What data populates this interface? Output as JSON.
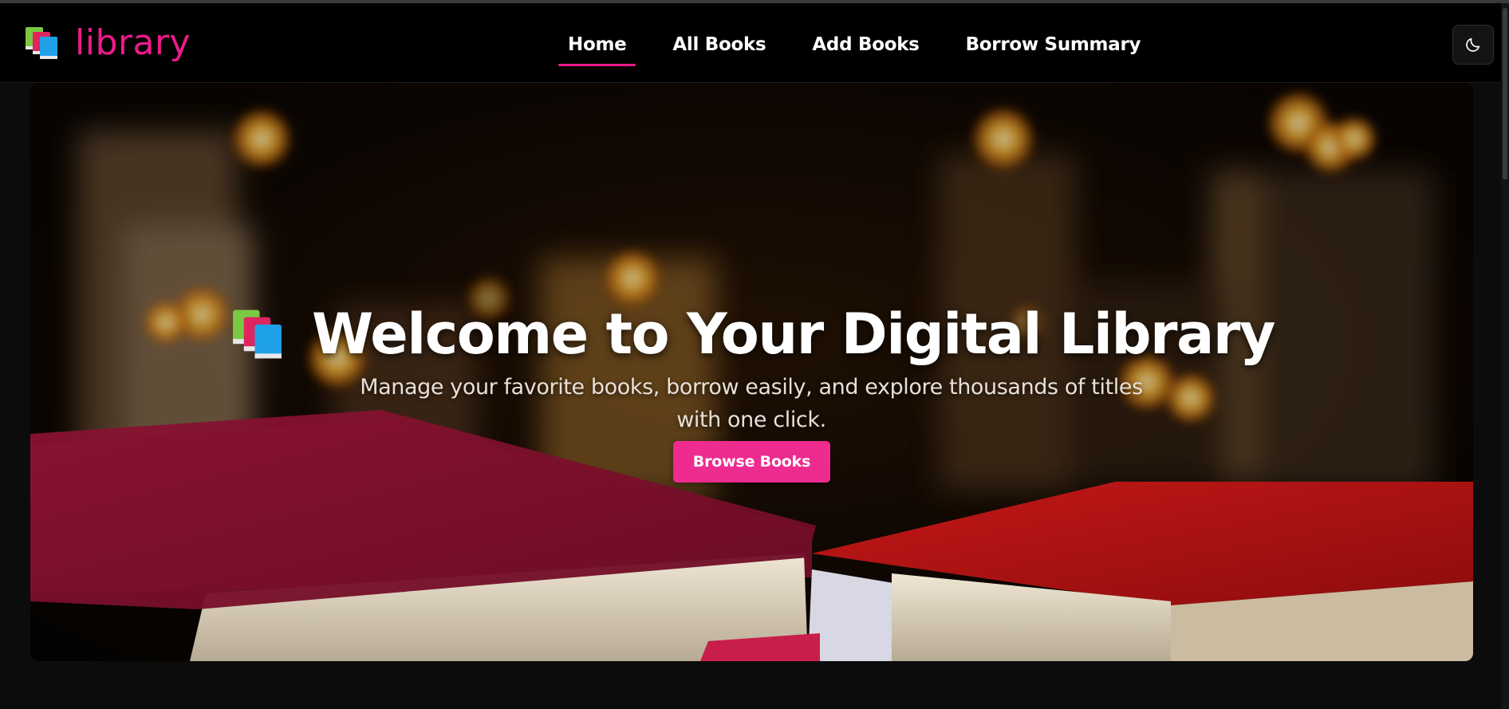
{
  "brand": {
    "name": "library",
    "icon": "books-icon"
  },
  "nav": {
    "links": [
      {
        "label": "Home",
        "active": true
      },
      {
        "label": "All Books",
        "active": false
      },
      {
        "label": "Add Books",
        "active": false
      },
      {
        "label": "Borrow Summary",
        "active": false
      }
    ]
  },
  "theme_toggle": {
    "icon": "moon-icon"
  },
  "hero": {
    "icon": "books-icon",
    "title": "Welcome to Your Digital Library",
    "subtitle": "Manage your favorite books, borrow easily, and explore thousands of titles with one click.",
    "cta_label": "Browse Books"
  },
  "colors": {
    "accent": "#ee1a8c",
    "button": "#ee2b8f",
    "navbar_bg": "#000000",
    "page_bg": "#0c0c0c"
  }
}
